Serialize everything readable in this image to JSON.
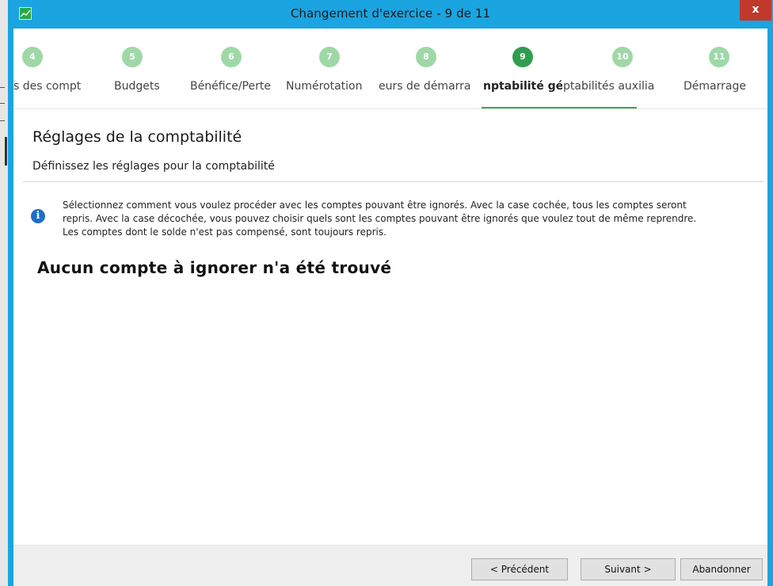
{
  "window": {
    "title": "Changement d'exercice - 9 de 11",
    "close_label": "x"
  },
  "steps": [
    {
      "number": "4",
      "label": "s des compt"
    },
    {
      "number": "5",
      "label": "Budgets"
    },
    {
      "number": "6",
      "label": "Bénéfice/Perte"
    },
    {
      "number": "7",
      "label": "Numérotation"
    },
    {
      "number": "8",
      "label": "eurs de démarra"
    },
    {
      "number": "9",
      "label": "nptabilité géné"
    },
    {
      "number": "10",
      "label": "ptabilités auxilia"
    },
    {
      "number": "11",
      "label": "Démarrage"
    }
  ],
  "current_step": "9",
  "colors": {
    "titlebar": "#1aa4e0",
    "step_done": "#9fd8a7",
    "step_active": "#2f9e4f",
    "close": "#c0392b",
    "info_icon": "#1e6fc8"
  },
  "page": {
    "title": "Réglages de la comptabilité",
    "subtitle": "Définissez les réglages pour la comptabilité",
    "info_icon": "info-icon",
    "info_lines": [
      "Sélectionnez comment vous voulez procéder avec les comptes pouvant être ignorés. Avec la case cochée, tous les comptes seront",
      "repris. Avec la case décochée, vous pouvez choisir quels sont les comptes pouvant être ignorés que voulez tout de même reprendre.",
      "Les comptes dont le solde n'est pas compensé, sont toujours repris."
    ],
    "headline": "Aucun compte à ignorer n'a été trouvé"
  },
  "footer": {
    "previous": "< Précédent",
    "next": "Suivant >",
    "cancel": "Abandonner"
  }
}
